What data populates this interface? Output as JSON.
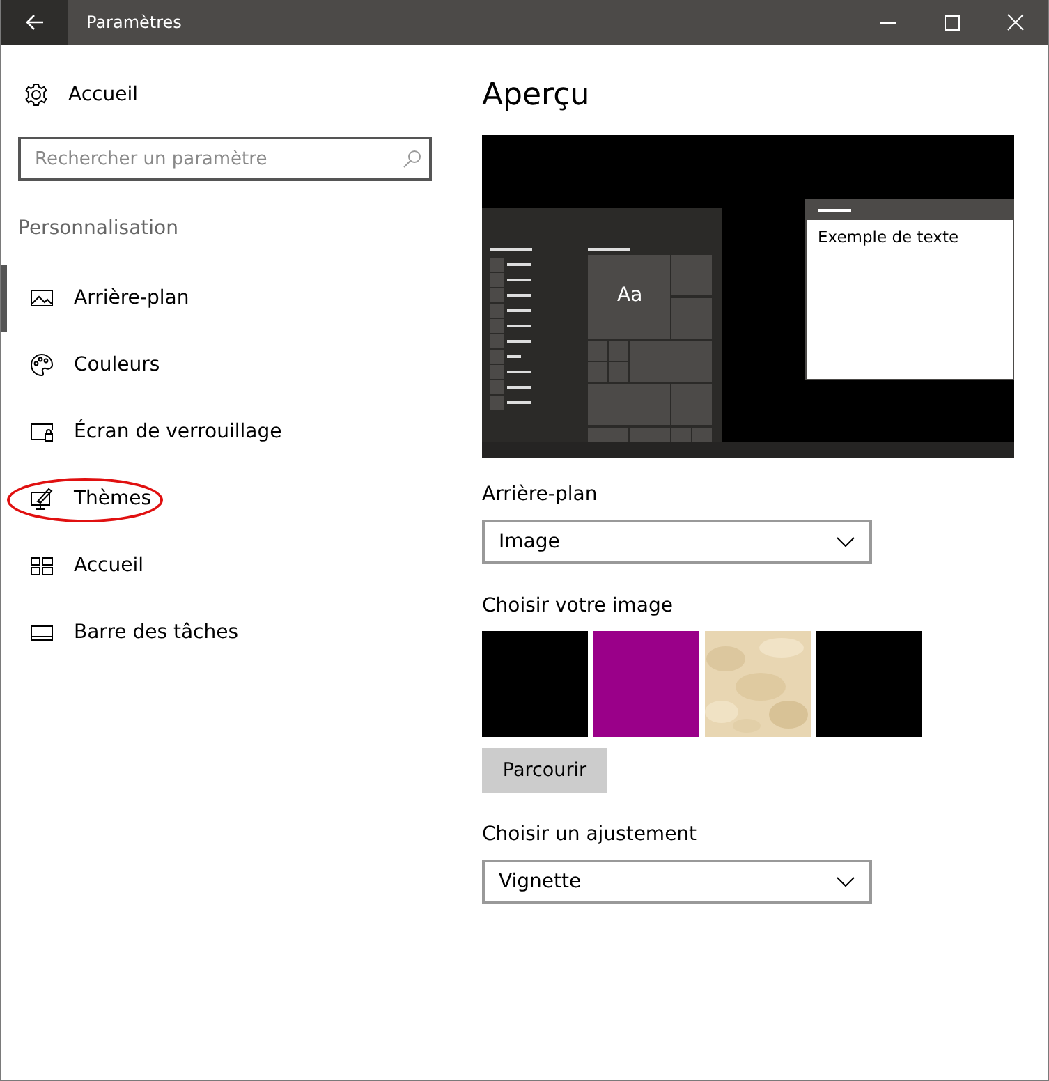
{
  "window": {
    "title": "Paramètres"
  },
  "sidebar": {
    "home": {
      "label": "Accueil"
    },
    "search": {
      "placeholder": "Rechercher un paramètre"
    },
    "section": "Personnalisation",
    "items": [
      {
        "kind": "background",
        "label": "Arrière-plan",
        "selected": true,
        "circled": false
      },
      {
        "kind": "colors",
        "label": "Couleurs",
        "selected": false,
        "circled": false
      },
      {
        "kind": "lockscreen",
        "label": "Écran de verrouillage",
        "selected": false,
        "circled": false
      },
      {
        "kind": "themes",
        "label": "Thèmes",
        "selected": false,
        "circled": true
      },
      {
        "kind": "start",
        "label": "Accueil",
        "selected": false,
        "circled": false
      },
      {
        "kind": "taskbar",
        "label": "Barre des tâches",
        "selected": false,
        "circled": false
      }
    ]
  },
  "content": {
    "title": "Aperçu",
    "preview": {
      "tile_text": "Aa",
      "window_text": "Exemple de texte"
    },
    "background": {
      "label": "Arrière-plan",
      "value": "Image"
    },
    "images": {
      "label": "Choisir votre image",
      "items": [
        {
          "kind": "color",
          "color": "#000000"
        },
        {
          "kind": "color",
          "color": "#9a0089"
        },
        {
          "kind": "picture"
        },
        {
          "kind": "color",
          "color": "#000000"
        }
      ],
      "browse": "Parcourir"
    },
    "fit": {
      "label": "Choisir un ajustement",
      "value": "Vignette"
    }
  }
}
